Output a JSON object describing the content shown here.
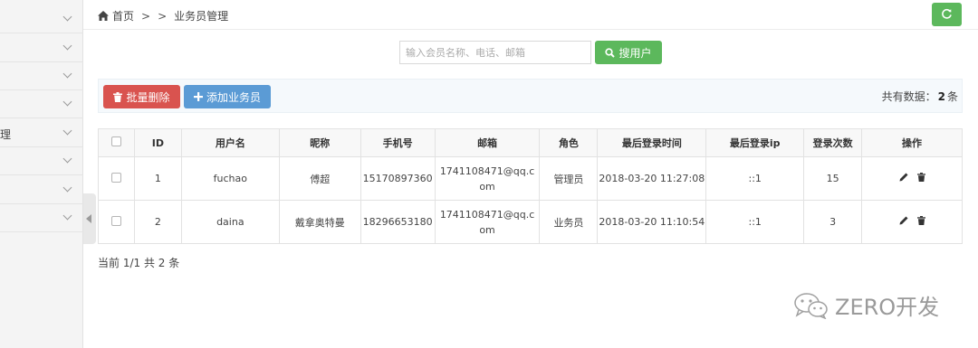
{
  "sidebar": {
    "items": [
      {
        "label": ""
      },
      {
        "label": ""
      },
      {
        "label": ""
      },
      {
        "label": ""
      },
      {
        "label": "理"
      },
      {
        "label": ""
      },
      {
        "label": ""
      },
      {
        "label": ""
      }
    ]
  },
  "breadcrumb": {
    "home": "首页",
    "sep1": ">",
    "sep2": ">",
    "current": "业务员管理"
  },
  "search": {
    "placeholder": "输入会员名称、电话、邮箱",
    "button_label": "搜用户"
  },
  "toolbar": {
    "delete_label": "批量删除",
    "add_label": "添加业务员",
    "total_prefix": "共有数据：",
    "total_count": "2",
    "total_suffix": "条"
  },
  "table": {
    "headers": [
      "ID",
      "用户名",
      "昵称",
      "手机号",
      "邮箱",
      "角色",
      "最后登录时间",
      "最后登录ip",
      "登录次数",
      "操作"
    ],
    "rows": [
      {
        "id": "1",
        "username": "fuchao",
        "nickname": "傅超",
        "phone": "15170897360",
        "email": "1741108471@qq.com",
        "role": "管理员",
        "last_login": "2018-03-20 11:27:08",
        "ip": "::1",
        "count": "15"
      },
      {
        "id": "2",
        "username": "daina",
        "nickname": "戴拿奥特曼",
        "phone": "18296653180",
        "email": "1741108471@qq.com",
        "role": "业务员",
        "last_login": "2018-03-20 11:10:54",
        "ip": "::1",
        "count": "3"
      }
    ]
  },
  "pager": {
    "text": "当前 1/1 共 2 条"
  },
  "watermark": {
    "text": "ZERO开发"
  },
  "colors": {
    "green": "#5cb85c",
    "red": "#d9534f",
    "blue": "#5b9bd5"
  },
  "icons": [
    "home-icon",
    "refresh-icon",
    "search-icon",
    "trash-icon",
    "plus-icon",
    "chevron-down-icon",
    "edit-icon",
    "collapse-arrow-icon",
    "wechat-icon"
  ]
}
